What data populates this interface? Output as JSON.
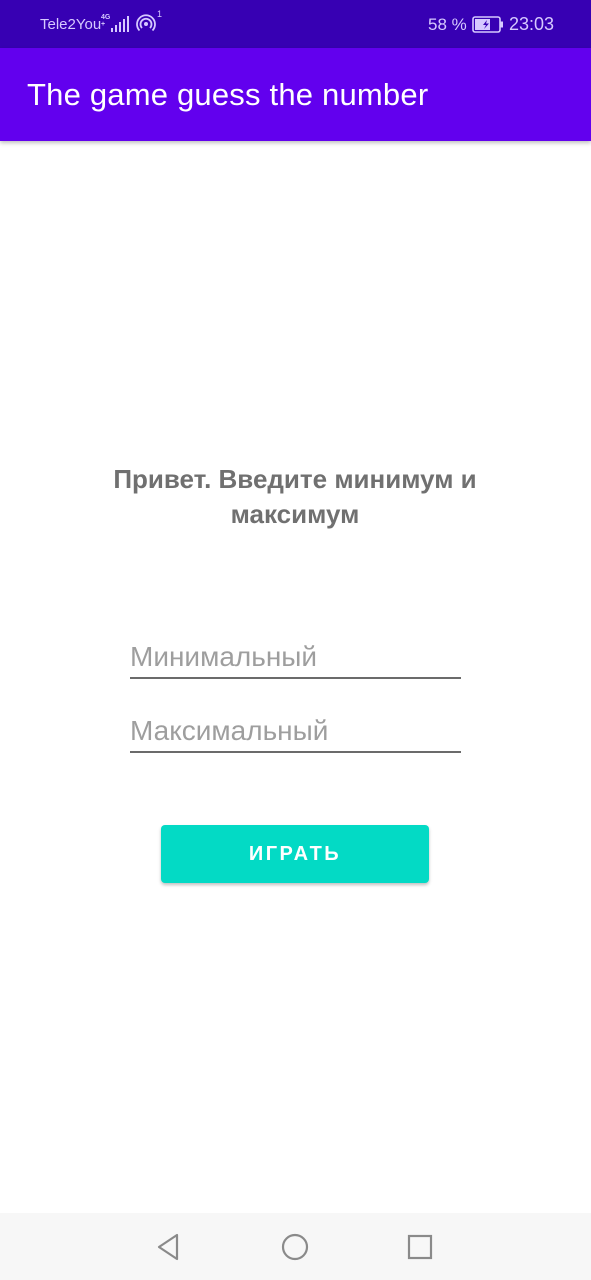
{
  "status_bar": {
    "carrier": "Tele2You",
    "network_type_top": "4G",
    "network_type_bottom": "+",
    "hotspot_count": "1",
    "battery_percent": "58 %",
    "time": "23:03",
    "icons": [
      "signal-icon",
      "hotspot-icon",
      "battery-charging-icon"
    ],
    "color_bg": "#3700b3"
  },
  "app_bar": {
    "title": "The game guess the number",
    "color_bg": "#6200ee"
  },
  "main": {
    "greeting": "Привет. Введите минимум и максимум",
    "min_field": {
      "value": "",
      "placeholder": "Минимальный"
    },
    "max_field": {
      "value": "",
      "placeholder": "Максимальный"
    },
    "play_button_label": "ИГРАТЬ",
    "accent_color": "#03dac5"
  },
  "nav_bar": {
    "icons": [
      "back-icon",
      "home-icon",
      "recent-apps-icon"
    ]
  }
}
